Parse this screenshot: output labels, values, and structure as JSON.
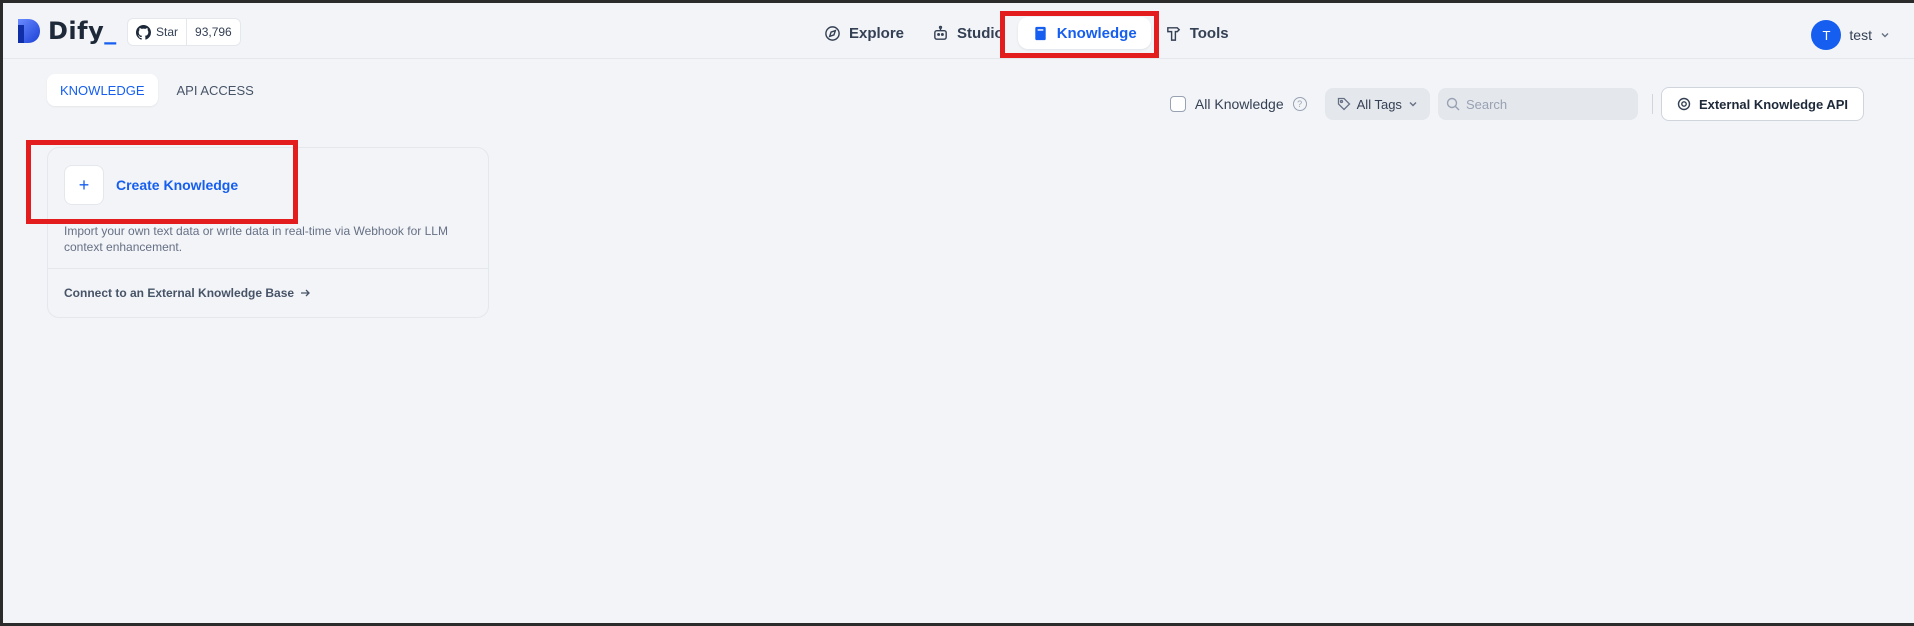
{
  "brand": {
    "name": "Dify",
    "underscore": "_",
    "accent": "#155eef"
  },
  "github": {
    "star_label": "Star",
    "count": "93,796"
  },
  "nav": {
    "items": [
      {
        "label": "Explore",
        "icon": "compass-icon"
      },
      {
        "label": "Studio",
        "icon": "robot-icon"
      },
      {
        "label": "Knowledge",
        "icon": "book-icon",
        "active": true
      },
      {
        "label": "Tools",
        "icon": "hammer-icon"
      }
    ]
  },
  "user": {
    "initial": "T",
    "name": "test"
  },
  "tabs": [
    {
      "label": "KNOWLEDGE",
      "active": true
    },
    {
      "label": "API ACCESS",
      "active": false
    }
  ],
  "toolbar": {
    "all_knowledge_label": "All Knowledge",
    "all_knowledge_checked": false,
    "tags_label": "All Tags",
    "search_placeholder": "Search",
    "external_api_label": "External Knowledge API"
  },
  "create_card": {
    "create_label": "Create Knowledge",
    "description": "Import your own text data or write data in real-time via Webhook for LLM context enhancement.",
    "connect_label": "Connect to an External Knowledge Base"
  },
  "annotations": {
    "highlight_color": "#e31d1d"
  }
}
